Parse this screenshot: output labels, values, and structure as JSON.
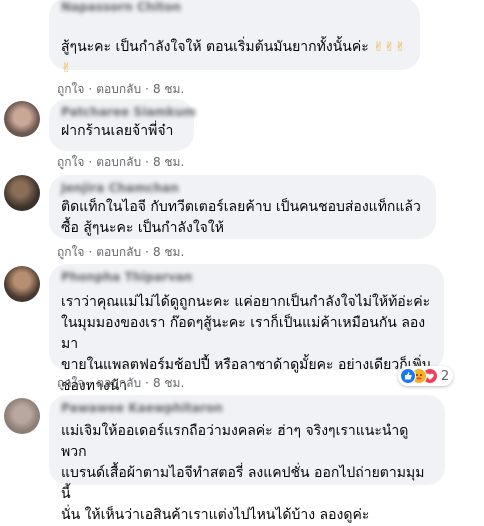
{
  "comments": [
    {
      "author": "Napassorn Chiton",
      "text": "สู้ๆนะคะ เป็นกำลังใจให้ ตอนเริ่มต้นมันยากทั้งนั้นค่ะ",
      "emoji": "✌✌✌\n✌",
      "like": "ถูกใจ",
      "reply": "ตอบกลับ",
      "time": "8 ชม."
    },
    {
      "author": "Patcharee Siamkum",
      "text": "ฝากร้านเลยจ้าพี่จ๋า",
      "like": "ถูกใจ",
      "reply": "ตอบกลับ",
      "time": "8 ชม."
    },
    {
      "author": "Jenjira Chamchan",
      "text": "ติดแท็กในไอจี กับทวีตเตอร์เลยค้าบ เป็นคนชอบส่องแท็กแล้ว\nซื้อ สู้ๆนะคะ เป็นกำลังใจให้",
      "like": "ถูกใจ",
      "reply": "ตอบกลับ",
      "time": "8 ชม."
    },
    {
      "author": "Phonpha Thiparvan",
      "text": "เราว่าคุณแม่ไม่ได้ดูถูกนะคะ แค่อยากเป็นกำลังใจไม่ให้ท้อ่ะค่ะ\nในมุมมองของเรา ก๊อดๆสู้นะคะ เราก็เป็นแม่ค้าเหมือนกัน ลองมา\nขายในแพลตฟอร์มช้อปปี้ หรือลาซาด้าดูมั้ยคะ อย่างเดียวก็เพิ่ม\nช่องทางน้า",
      "like": "ถูกใจ",
      "reply": "ตอบกลับ",
      "time": "8 ชม.",
      "reaction_count": "2"
    },
    {
      "author": "Pawawee Kaewphitaron",
      "text": "แม่เจิมให้ออเดอร์แรกถือว่ามงคลค่ะ ฮ่าๆ จริงๆเราแนะนำดูพวก\nแบรนด์เสื้อผ้าตามไอจีทำสตอรี่ ลงแคปชั่น ออกไปถ่ายตามมุมนี้\nนั่น ให้เห็นว่าเอสินค้าเราแต่งไปไหนได้บ้าง ลองดูค่ะ"
    }
  ],
  "colors": {
    "bubble": "#f0f2f5",
    "meta_text": "#65676b",
    "like_blue": "#1877f2",
    "care_yellow": "#f7b125",
    "heart_red": "#f33e58"
  },
  "icons": {
    "reaction_like": "thumbs-up-icon",
    "reaction_care": "care-icon",
    "reaction_love": "heart-icon"
  }
}
